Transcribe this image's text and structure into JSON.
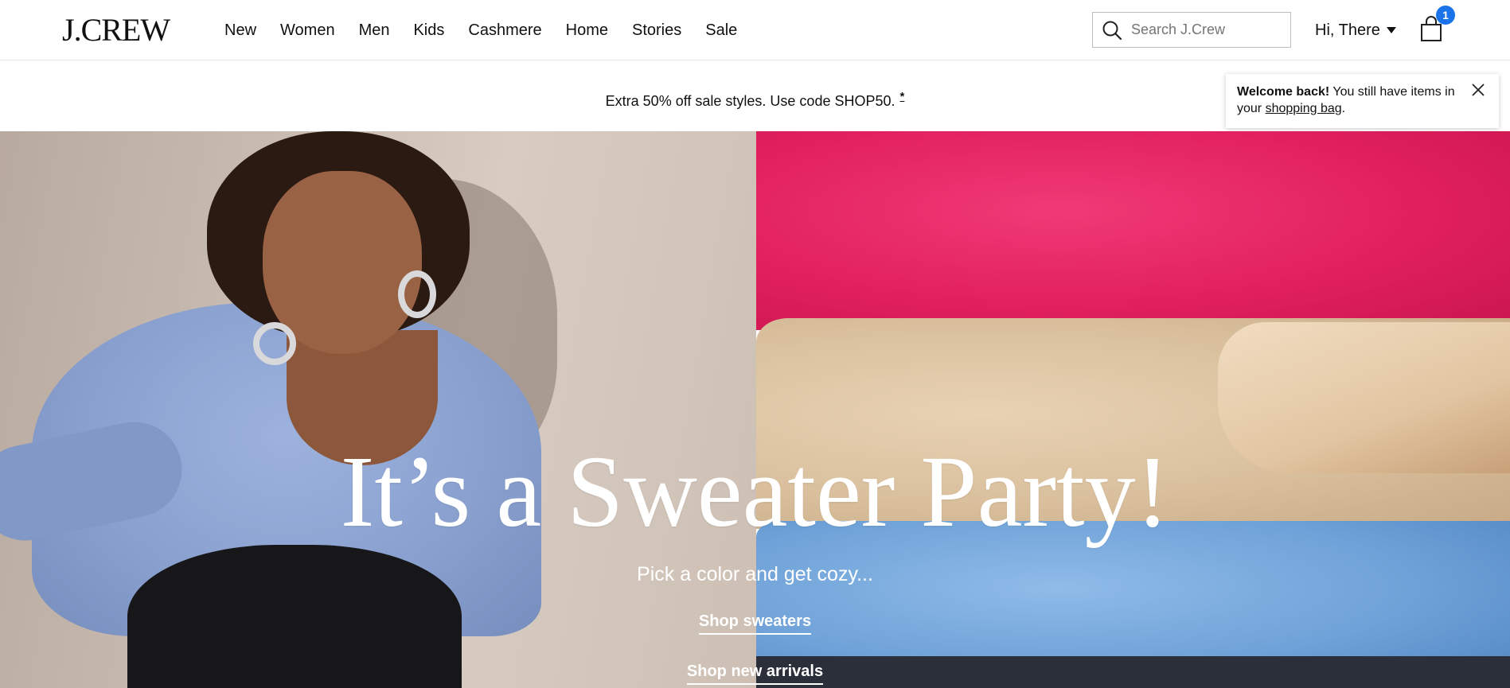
{
  "header": {
    "logo": "J.CREW",
    "nav": [
      "New",
      "Women",
      "Men",
      "Kids",
      "Cashmere",
      "Home",
      "Stories",
      "Sale"
    ],
    "search_placeholder": "Search J.Crew",
    "account_label": "Hi, There",
    "bag_count": "1",
    "icons": {
      "search": "search-icon",
      "caret": "chevron-down-icon",
      "bag": "shopping-bag-icon"
    },
    "badge_color": "#1a73e8"
  },
  "promo": {
    "text": "Extra 50% off sale styles. Use code SHOP50.",
    "asterisk": "*"
  },
  "toast": {
    "bold": "Welcome back!",
    "text_before_link": " You still have items in your ",
    "link": "shopping bag",
    "text_after_link": "."
  },
  "hero": {
    "title": "It’s a Sweater Party!",
    "subtitle": "Pick a color and get cozy...",
    "cta_primary": "Shop sweaters",
    "cta_secondary": "Shop new arrivals"
  }
}
